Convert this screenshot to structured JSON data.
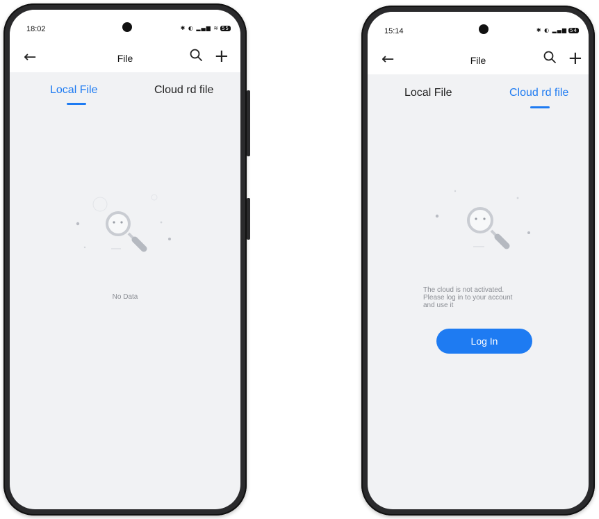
{
  "colors": {
    "accent": "#1e7bf2",
    "background": "#f1f2f4"
  },
  "left_phone": {
    "status": {
      "time": "18:02",
      "battery": "55"
    },
    "appbar": {
      "title": "File",
      "back_icon": "arrow-left-icon",
      "search_icon": "search-icon",
      "add_icon": "plus-icon"
    },
    "tabs": [
      {
        "label": "Local File",
        "active": true
      },
      {
        "label": "Cloud rd file",
        "active": false
      }
    ],
    "empty": {
      "message": "No Data"
    }
  },
  "right_phone": {
    "status": {
      "time": "15:14",
      "battery": "54"
    },
    "appbar": {
      "title": "File",
      "back_icon": "arrow-left-icon",
      "search_icon": "search-icon",
      "add_icon": "plus-icon"
    },
    "tabs": [
      {
        "label": "Local File",
        "active": false
      },
      {
        "label": "Cloud rd file",
        "active": true
      }
    ],
    "empty": {
      "message_lines": [
        "The cloud is not activated.",
        "Please log in to your account",
        "and use it"
      ],
      "button_label": "Log In"
    }
  }
}
